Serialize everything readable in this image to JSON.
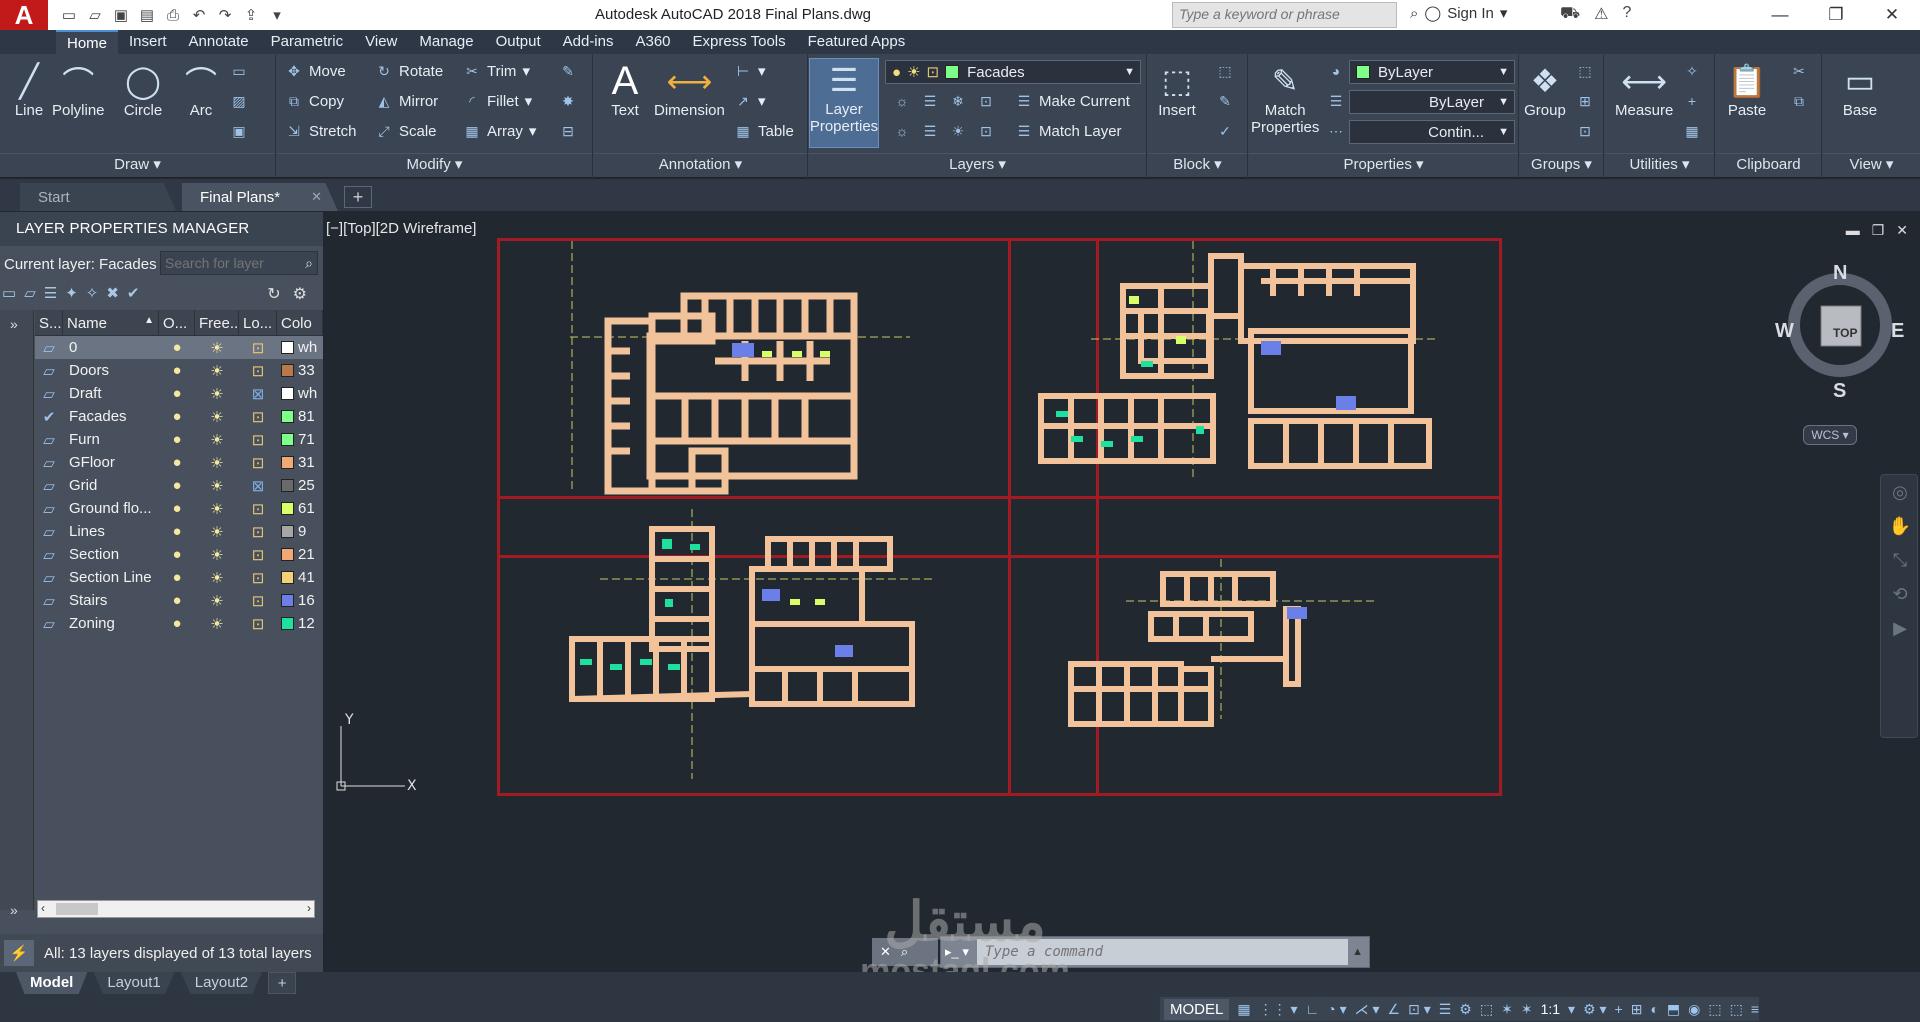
{
  "app": {
    "logo": "A",
    "title": "Autodesk AutoCAD 2018    Final Plans.dwg",
    "search_placeholder": "Type a keyword or phrase",
    "sign_in": "Sign In"
  },
  "ribbon_tabs": [
    "Home",
    "Insert",
    "Annotate",
    "Parametric",
    "View",
    "Manage",
    "Output",
    "Add-ins",
    "A360",
    "Express Tools",
    "Featured Apps"
  ],
  "ribbon": {
    "draw": {
      "title": "Draw",
      "line": "Line",
      "polyline": "Polyline",
      "circle": "Circle",
      "arc": "Arc"
    },
    "modify": {
      "title": "Modify",
      "move": "Move",
      "rotate": "Rotate",
      "trim": "Trim",
      "copy": "Copy",
      "mirror": "Mirror",
      "fillet": "Fillet",
      "stretch": "Stretch",
      "scale": "Scale",
      "array": "Array"
    },
    "annotation": {
      "title": "Annotation",
      "text": "Text",
      "dimension": "Dimension",
      "table": "Table"
    },
    "layers": {
      "title": "Layers",
      "layer_properties_1": "Layer",
      "layer_properties_2": "Properties",
      "current": "Facades",
      "current_color": "#7dff8a",
      "make_current": "Make Current",
      "match_layer": "Match Layer"
    },
    "block": {
      "title": "Block",
      "insert": "Insert"
    },
    "properties": {
      "title": "Properties",
      "match_1": "Match",
      "match_2": "Properties",
      "color": "ByLayer",
      "lineweight": "ByLayer",
      "linetype": "Contin..."
    },
    "groups": {
      "title": "Groups",
      "group": "Group"
    },
    "utilities": {
      "title": "Utilities",
      "measure": "Measure"
    },
    "clipboard": {
      "title": "Clipboard",
      "paste": "Paste"
    },
    "view": {
      "title": "View",
      "base": "Base"
    }
  },
  "doc_tabs": [
    "Start",
    "Final Plans*"
  ],
  "lpm": {
    "title": "LAYER PROPERTIES MANAGER",
    "current_layer": "Current layer: Facades",
    "search_placeholder": "Search for layer",
    "columns": [
      "S...",
      "Name",
      "O...",
      "Free...",
      "Lo...",
      "Colo"
    ],
    "layers": [
      {
        "name": "0",
        "color": "#ffffff",
        "color_text": "wh",
        "locked": false,
        "selected": true
      },
      {
        "name": "Doors",
        "color": "#b87a4b",
        "color_text": "33",
        "locked": false,
        "selected": false
      },
      {
        "name": "Draft",
        "color": "#ffffff",
        "color_text": "wh",
        "locked": true,
        "selected": false
      },
      {
        "name": "Facades",
        "color": "#7dff8a",
        "color_text": "81",
        "locked": false,
        "current": true,
        "selected": false
      },
      {
        "name": "Furn",
        "color": "#7dff8a",
        "color_text": "71",
        "locked": false,
        "selected": false
      },
      {
        "name": "GFloor",
        "color": "#f0a874",
        "color_text": "31",
        "locked": false,
        "selected": false
      },
      {
        "name": "Grid",
        "color": "#6a6a6a",
        "color_text": "25",
        "locked": true,
        "selected": false
      },
      {
        "name": "Ground flo...",
        "color": "#d8ff6a",
        "color_text": "61",
        "locked": false,
        "selected": false
      },
      {
        "name": "Lines",
        "color": "#a6a6a6",
        "color_text": "9",
        "locked": false,
        "selected": false
      },
      {
        "name": "Section",
        "color": "#f0a874",
        "color_text": "21",
        "locked": false,
        "selected": false
      },
      {
        "name": "Section Line",
        "color": "#f4d07a",
        "color_text": "41",
        "locked": false,
        "selected": false
      },
      {
        "name": "Stairs",
        "color": "#6a7fe8",
        "color_text": "16",
        "locked": false,
        "selected": false
      },
      {
        "name": "Zoning",
        "color": "#20e0a0",
        "color_text": "12",
        "locked": false,
        "selected": false
      }
    ],
    "status": "All: 13 layers displayed of 13 total layers"
  },
  "viewport": {
    "label": "[−][Top][2D Wireframe]",
    "compass": {
      "n": "N",
      "s": "S",
      "e": "E",
      "w": "W",
      "top": "TOP"
    },
    "wcs": "WCS"
  },
  "command": {
    "placeholder": "Type a command"
  },
  "layout_tabs": [
    "Model",
    "Layout1",
    "Layout2"
  ],
  "status": {
    "model": "MODEL",
    "scale": "1:1"
  },
  "watermark": {
    "arabic": "مستقل",
    "latin": "mostaql.com"
  }
}
